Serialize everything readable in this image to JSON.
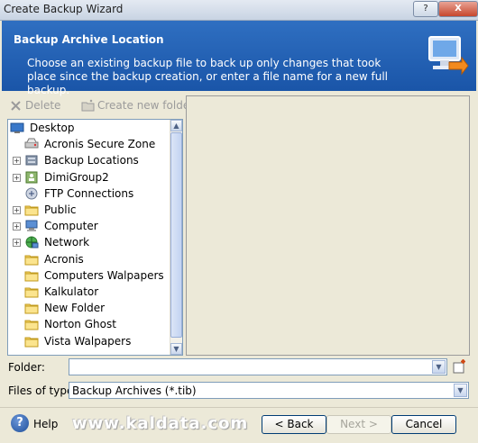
{
  "window": {
    "title": "Create Backup Wizard",
    "help_glyph": "?",
    "close_glyph": "X"
  },
  "header": {
    "title": "Backup Archive Location",
    "description": "Choose an existing backup file to back up only changes that took place since the backup creation, or enter a file name for a new full backup.",
    "icon": "computer-arrow-icon"
  },
  "toolbar": {
    "delete_label": "Delete",
    "new_folder_label": "Create new folder"
  },
  "tree": {
    "items": [
      {
        "label": "Desktop",
        "icon": "desktop-icon",
        "level": 0,
        "expandable": false
      },
      {
        "label": "Acronis Secure Zone",
        "icon": "secure-zone-icon",
        "level": 1,
        "expandable": false
      },
      {
        "label": "Backup Locations",
        "icon": "backup-locations-icon",
        "level": 1,
        "expandable": true
      },
      {
        "label": "DimiGroup2",
        "icon": "user-folder-icon",
        "level": 1,
        "expandable": true
      },
      {
        "label": "FTP Connections",
        "icon": "ftp-icon",
        "level": 1,
        "expandable": false
      },
      {
        "label": "Public",
        "icon": "folder-icon",
        "level": 1,
        "expandable": true
      },
      {
        "label": "Computer",
        "icon": "computer-icon",
        "level": 1,
        "expandable": true
      },
      {
        "label": "Network",
        "icon": "network-icon",
        "level": 1,
        "expandable": true
      },
      {
        "label": "Acronis",
        "icon": "folder-icon",
        "level": 1,
        "expandable": false
      },
      {
        "label": "Computers Walpapers",
        "icon": "folder-icon",
        "level": 1,
        "expandable": false
      },
      {
        "label": "Kalkulator",
        "icon": "folder-icon",
        "level": 1,
        "expandable": false
      },
      {
        "label": "New Folder",
        "icon": "folder-icon",
        "level": 1,
        "expandable": false
      },
      {
        "label": "Norton Ghost",
        "icon": "folder-icon",
        "level": 1,
        "expandable": false
      },
      {
        "label": "Vista Walpapers",
        "icon": "folder-icon",
        "level": 1,
        "expandable": false
      }
    ]
  },
  "folder": {
    "label": "Folder:",
    "value": ""
  },
  "files_of_type": {
    "label": "Files of type:",
    "value": "Backup Archives (*.tib)"
  },
  "footer": {
    "help_label": "Help",
    "watermark": "www.kaldata.com",
    "back_label": "< Back",
    "next_label": "Next >",
    "cancel_label": "Cancel"
  }
}
